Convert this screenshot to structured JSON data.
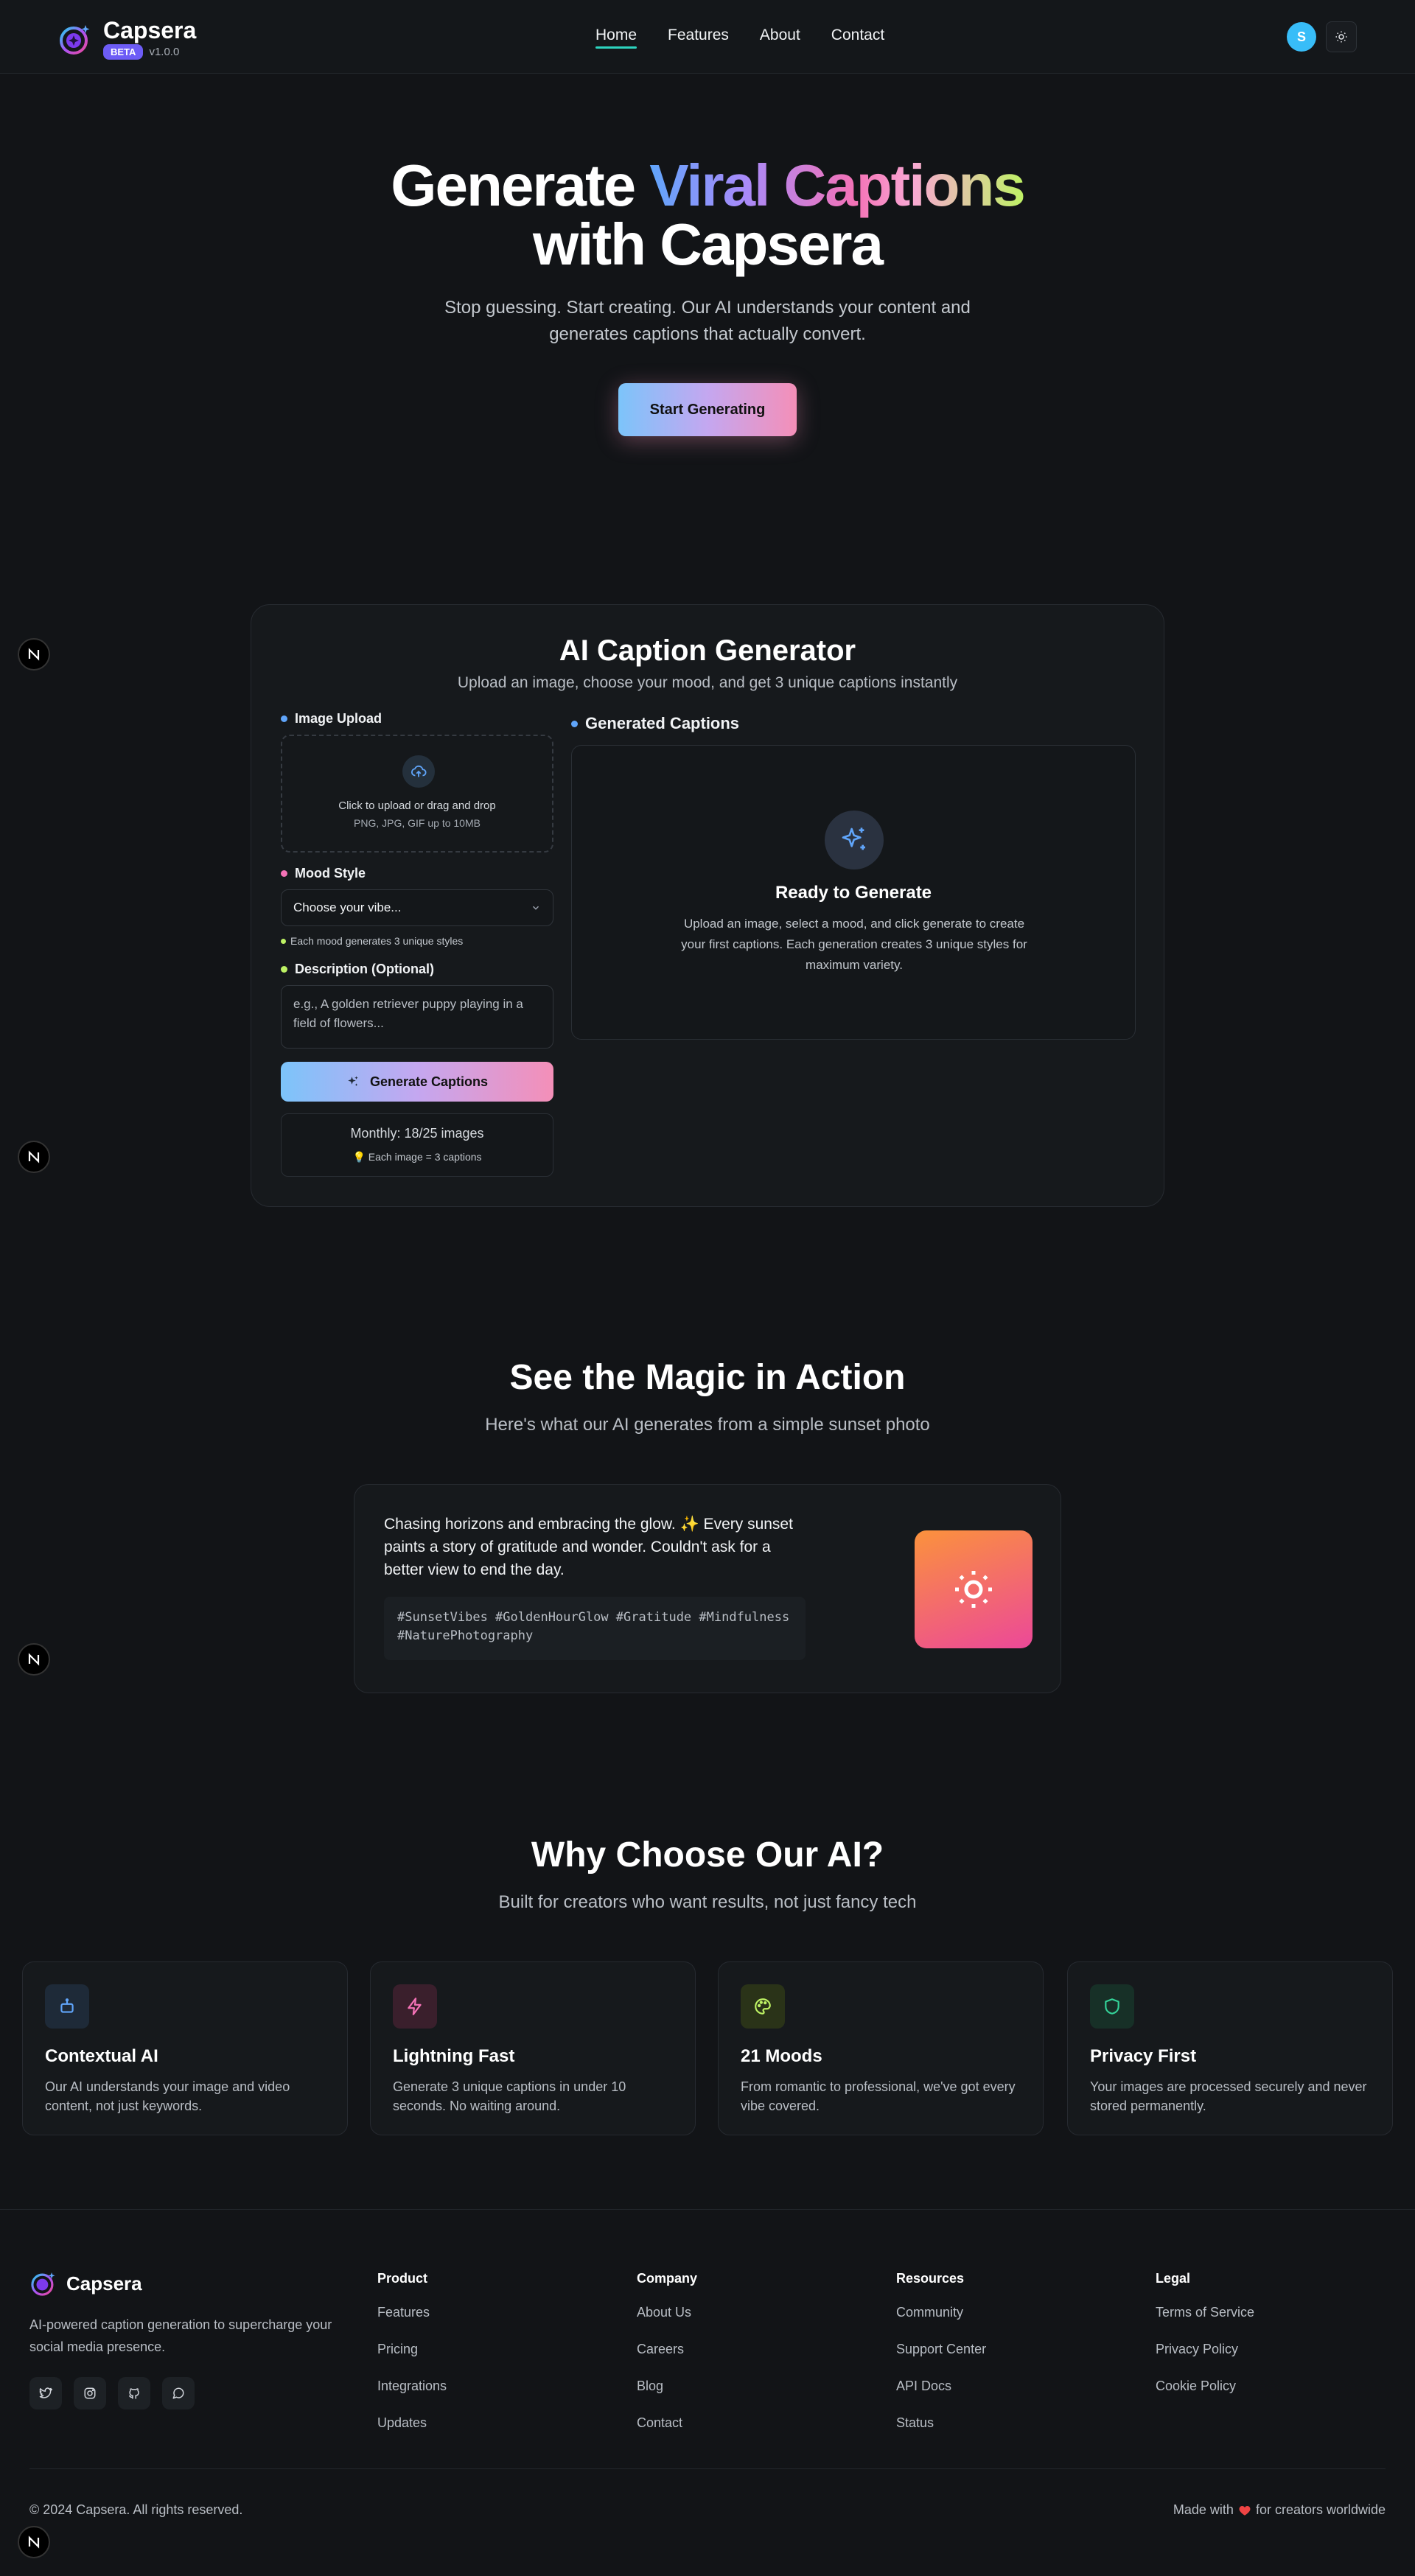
{
  "header": {
    "brand_name": "Capsera",
    "beta_badge": "BETA",
    "version": "v1.0.0",
    "nav": [
      {
        "label": "Home",
        "active": true
      },
      {
        "label": "Features",
        "active": false
      },
      {
        "label": "About",
        "active": false
      },
      {
        "label": "Contact",
        "active": false
      }
    ],
    "avatar_initial": "S",
    "theme_icon": "sun-icon"
  },
  "hero": {
    "title_part1": "Generate ",
    "title_highlight": "Viral Captions",
    "title_line2": "with Capsera",
    "subtitle": "Stop guessing. Start creating. Our AI understands your content and generates captions that actually convert.",
    "cta_label": "Start Generating"
  },
  "generator": {
    "title": "AI Caption Generator",
    "subtitle": "Upload an image, choose your mood, and get 3 unique captions instantly",
    "upload_label": "Image Upload",
    "upload_text": "Click to upload or drag and drop",
    "upload_formats": "PNG, JPG, GIF up to 10MB",
    "mood_label": "Mood Style",
    "mood_value": "Choose your vibe...",
    "mood_hint": "Each mood generates 3 unique styles",
    "description_label": "Description (Optional)",
    "description_placeholder": "e.g., A golden retriever puppy playing in a field of flowers...",
    "generate_label": "Generate Captions",
    "quota_text": "Monthly: 18/25 images",
    "quota_hint": "💡 Each image = 3 captions",
    "output_label": "Generated Captions",
    "ready_title": "Ready to Generate",
    "ready_text": "Upload an image, select a mood, and click generate to create your first captions. Each generation creates 3 unique styles for maximum variety."
  },
  "magic": {
    "title": "See the Magic in Action",
    "subtitle": "Here's what our AI generates from a simple sunset photo",
    "caption": "Chasing horizons and embracing the glow. ✨ Every sunset paints a story of gratitude and wonder. Couldn't ask for a better view to end the day.",
    "hashtags": "#SunsetVibes #GoldenHourGlow #Gratitude #Mindfulness #NaturePhotography"
  },
  "why": {
    "title": "Why Choose Our AI?",
    "subtitle": "Built for creators who want results, not just fancy tech",
    "features": [
      {
        "title": "Contextual AI",
        "text": "Our AI understands your image and video content, not just keywords.",
        "icon": "robot-icon",
        "color": "#60a5fa"
      },
      {
        "title": "Lightning Fast",
        "text": "Generate 3 unique captions in under 10 seconds. No waiting around.",
        "icon": "lightning-icon",
        "color": "#f472b6"
      },
      {
        "title": "21 Moods",
        "text": "From romantic to professional, we've got every vibe covered.",
        "icon": "palette-icon",
        "color": "#bef264"
      },
      {
        "title": "Privacy First",
        "text": "Your images are processed securely and never stored permanently.",
        "icon": "shield-icon",
        "color": "#34d399"
      }
    ]
  },
  "footer": {
    "brand_name": "Capsera",
    "description": "AI-powered caption generation to supercharge your social media presence.",
    "columns": [
      {
        "heading": "Product",
        "links": [
          "Features",
          "Pricing",
          "Integrations",
          "Updates"
        ]
      },
      {
        "heading": "Company",
        "links": [
          "About Us",
          "Careers",
          "Blog",
          "Contact"
        ]
      },
      {
        "heading": "Resources",
        "links": [
          "Community",
          "Support Center",
          "API Docs",
          "Status"
        ]
      },
      {
        "heading": "Legal",
        "links": [
          "Terms of Service",
          "Privacy Policy",
          "Cookie Policy"
        ]
      }
    ],
    "copyright": "© 2024 Capsera. All rights reserved.",
    "made_prefix": "Made with",
    "made_suffix": "for creators worldwide"
  }
}
